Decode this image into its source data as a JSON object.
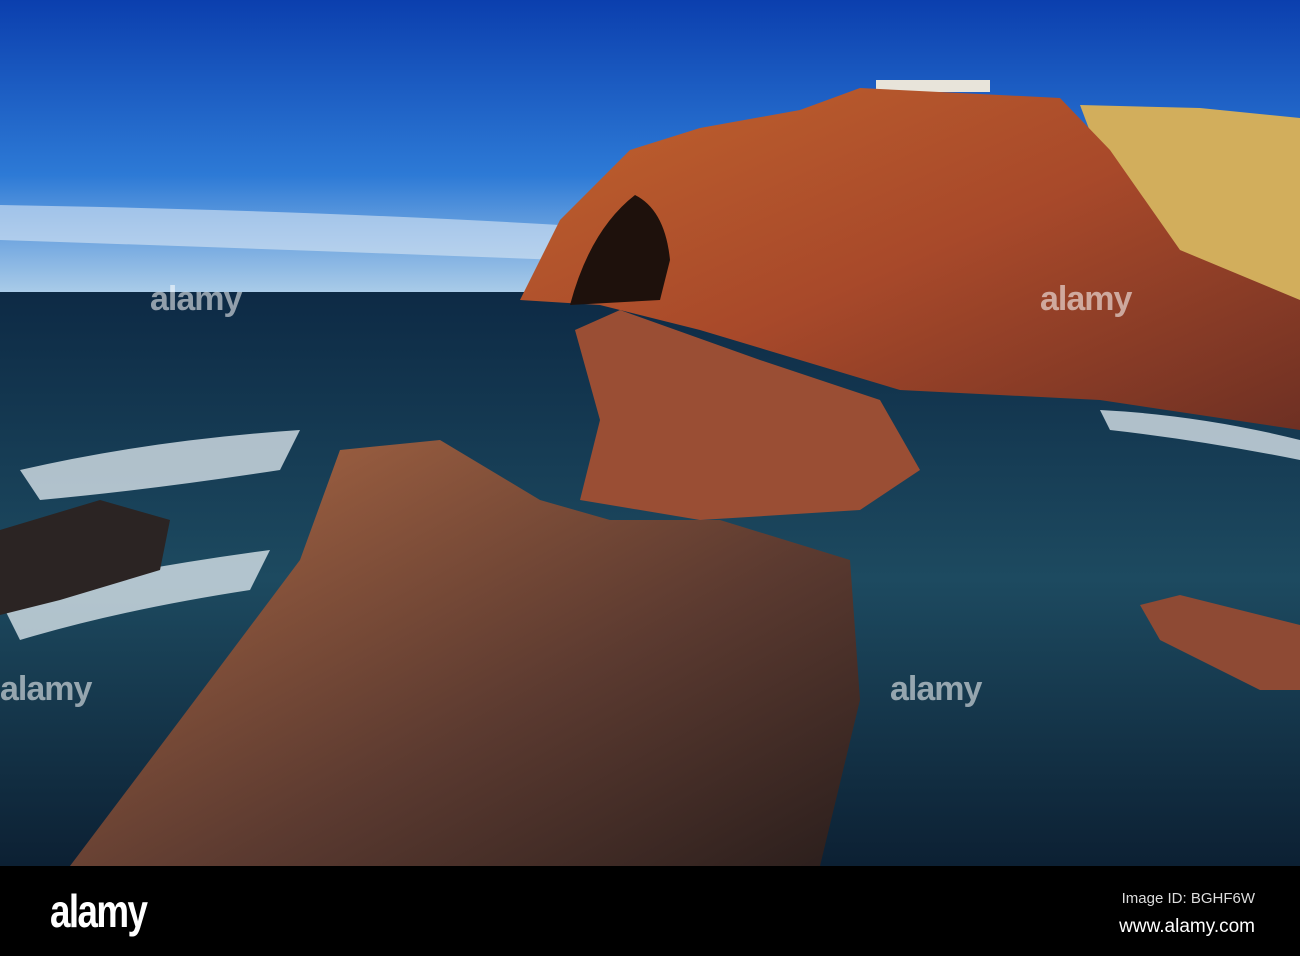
{
  "watermark": {
    "logo": "alamy",
    "overlay_text": "alamy"
  },
  "footer": {
    "image_id": "Image ID: BGHF6W",
    "website": "www.alamy.com"
  }
}
